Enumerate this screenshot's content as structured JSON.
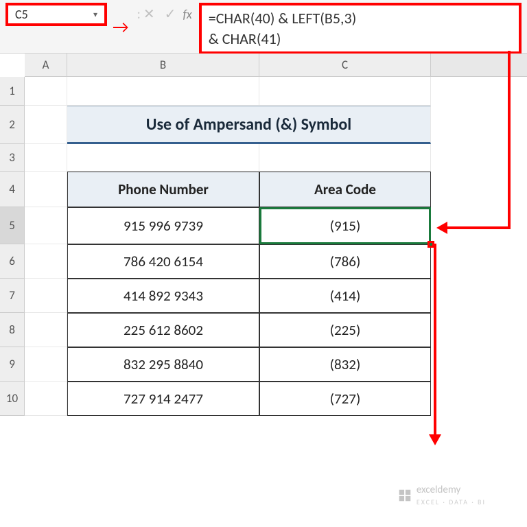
{
  "name_box": {
    "value": "C5"
  },
  "formula": {
    "line1": "=CHAR(40) & LEFT(B5,3)",
    "line2": "& CHAR(41)"
  },
  "fx_label": "fx",
  "columns": {
    "A": "A",
    "B": "B",
    "C": "C"
  },
  "rows": [
    "1",
    "2",
    "3",
    "4",
    "5",
    "6",
    "7",
    "8",
    "9",
    "10"
  ],
  "title": "Use of Ampersand (&) Symbol",
  "headers": {
    "phone": "Phone Number",
    "area": "Area Code"
  },
  "data": [
    {
      "phone": "915 996 9739",
      "area": "(915)"
    },
    {
      "phone": "786 420 6154",
      "area": "(786)"
    },
    {
      "phone": "414 892 9343",
      "area": "(414)"
    },
    {
      "phone": "225 612 8602",
      "area": "(225)"
    },
    {
      "phone": "832 295 8840",
      "area": "(832)"
    },
    {
      "phone": "727 914 2477",
      "area": "(727)"
    }
  ],
  "watermark": {
    "name": "exceldemy",
    "sub": "EXCEL · DATA · BI"
  },
  "chart_data": {
    "type": "table",
    "title": "Use of Ampersand (&) Symbol",
    "columns": [
      "Phone Number",
      "Area Code"
    ],
    "rows": [
      [
        "915 996 9739",
        "(915)"
      ],
      [
        "786 420 6154",
        "(786)"
      ],
      [
        "414 892 9343",
        "(414)"
      ],
      [
        "225 612 8602",
        "(225)"
      ],
      [
        "832 295 8840",
        "(832)"
      ],
      [
        "727 914 2477",
        "(727)"
      ]
    ],
    "formula_cell": "C5",
    "formula": "=CHAR(40) & LEFT(B5,3) & CHAR(41)"
  }
}
